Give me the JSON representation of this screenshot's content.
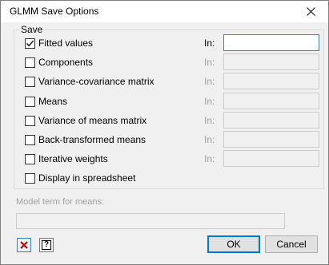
{
  "window": {
    "title": "GLMM Save Options",
    "close_icon": "close-icon"
  },
  "save_group": {
    "legend": "Save",
    "in_label": "In:",
    "options": [
      {
        "label": "Fitted values",
        "checked": true,
        "enabled": true,
        "value": ""
      },
      {
        "label": "Components",
        "checked": false,
        "enabled": false,
        "value": ""
      },
      {
        "label": "Variance-covariance matrix",
        "checked": false,
        "enabled": false,
        "value": ""
      },
      {
        "label": "Means",
        "checked": false,
        "enabled": false,
        "value": ""
      },
      {
        "label": "Variance of means matrix",
        "checked": false,
        "enabled": false,
        "value": ""
      },
      {
        "label": "Back-transformed means",
        "checked": false,
        "enabled": false,
        "value": ""
      },
      {
        "label": "Iterative weights",
        "checked": false,
        "enabled": false,
        "value": ""
      },
      {
        "label": "Display in spreadsheet",
        "checked": false
      }
    ]
  },
  "model_term": {
    "label": "Model term for  means:",
    "value": ""
  },
  "footer": {
    "clear_icon": "red-x-icon",
    "help_icon": "help-icon",
    "help_glyph": "?",
    "ok_label": "OK",
    "cancel_label": "Cancel"
  },
  "colors": {
    "clear_icon": "#c00000",
    "focus_border": "#3c7fb1",
    "default_button_border": "#0078d7",
    "disabled_text": "#a0a0a0"
  }
}
